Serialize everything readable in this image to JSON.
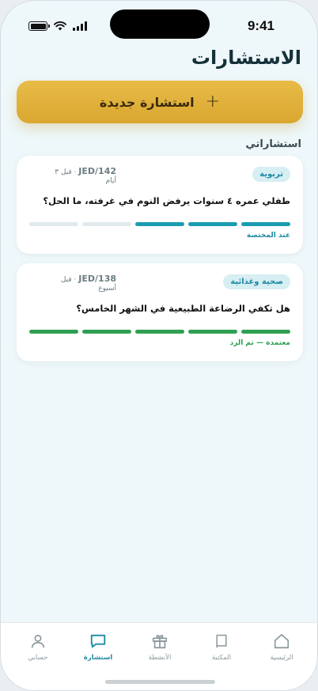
{
  "status_bar": {
    "time": "9:41"
  },
  "header": {
    "title": "الاستشارات"
  },
  "new_button": {
    "label": "استشارة جديدة",
    "plus": "+"
  },
  "section": {
    "title": "استشاراتي"
  },
  "cards": [
    {
      "category": "تربوية",
      "ref": "JED/142",
      "time_ago": "· قبل ٣",
      "time_unit": "أيام",
      "question": "طفلي عمره ٤ سنوات يرفض النوم في غرفته، ما الحل؟",
      "progress": {
        "filled": 3,
        "total": 5,
        "color": "#1a9cb0"
      },
      "status": "عند المختصة",
      "status_color": "#1c8aa3"
    },
    {
      "category": "صحية وغذائية",
      "ref": "JED/138",
      "time_ago": "· قبل",
      "time_unit": "أسبوع",
      "question": "هل تكفي الرضاعة الطبيعية في الشهر الخامس؟",
      "progress": {
        "filled": 5,
        "total": 5,
        "color": "#2fa052"
      },
      "status": "معتمدة — تم الرد",
      "status_color": "#2fa052"
    }
  ],
  "tab_bar": {
    "items": [
      {
        "label": "الرئيسية",
        "icon": "home-icon"
      },
      {
        "label": "المكتبة",
        "icon": "book-icon"
      },
      {
        "label": "الأنشطة",
        "icon": "gift-icon"
      },
      {
        "label": "استشارة",
        "icon": "chat-icon"
      },
      {
        "label": "حسابي",
        "icon": "person-icon"
      }
    ],
    "active": 3
  },
  "colors": {
    "accent": "#1c8aa3",
    "gold": "#dcaa33",
    "success": "#2fa052"
  }
}
